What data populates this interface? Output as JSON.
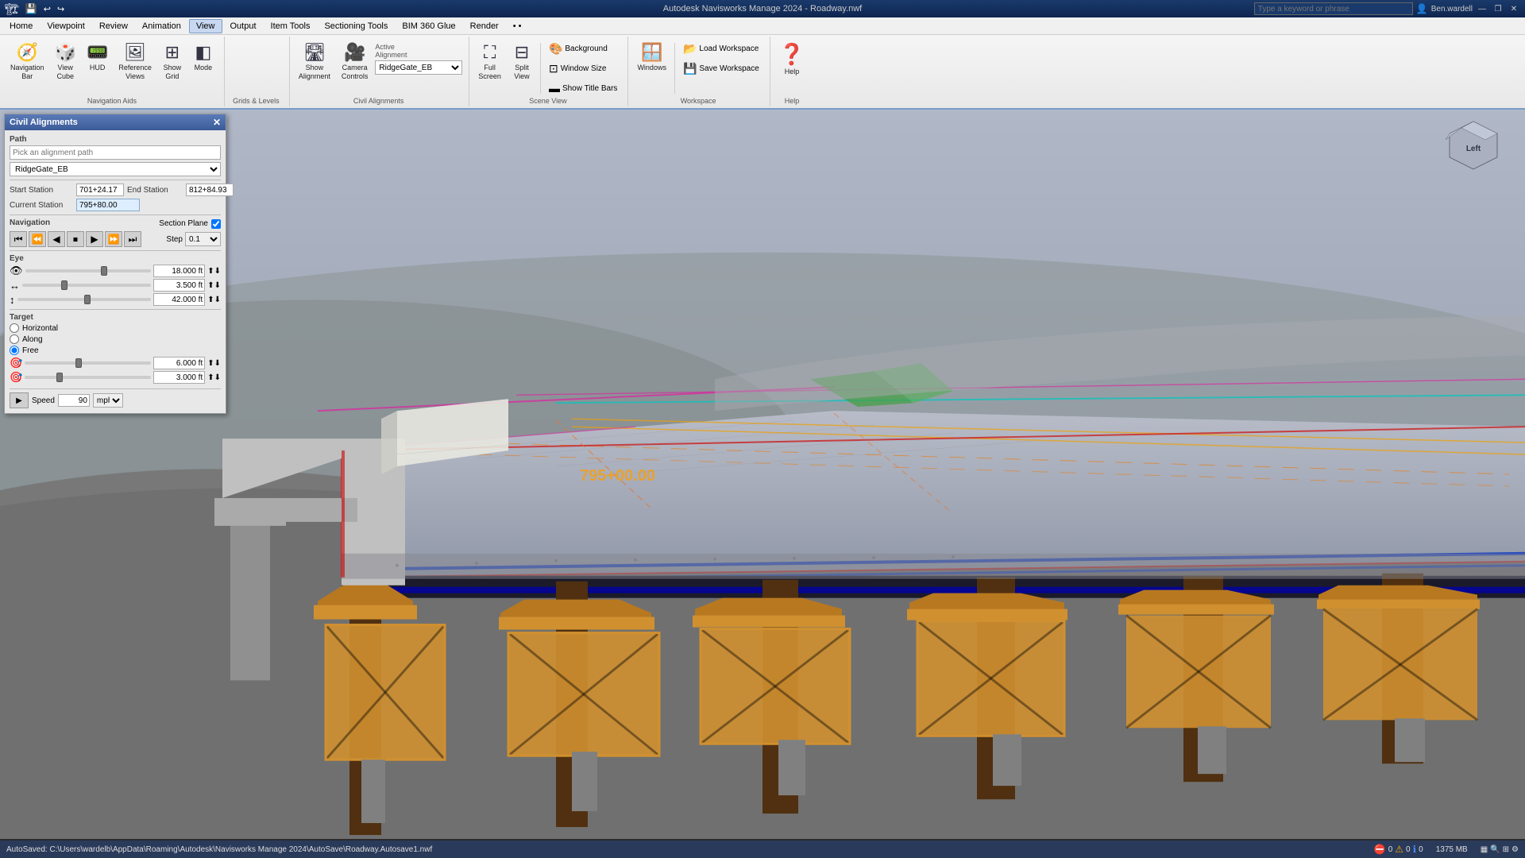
{
  "titlebar": {
    "app_name": "Autodesk Navisworks Manage 2024",
    "file": "Roadway.nwf",
    "title": "Autodesk Navisworks Manage 2024 - Roadway.nwf",
    "search_placeholder": "Type a keyword or phrase",
    "user": "Ben.wardell",
    "minimize": "—",
    "restore": "❐",
    "close": "✕"
  },
  "menu": {
    "items": [
      "Home",
      "Viewpoint",
      "Review",
      "Animation",
      "View",
      "Output",
      "Item Tools",
      "Sectioning Tools",
      "BIM 360 Glue",
      "Render",
      "• •"
    ]
  },
  "ribbon": {
    "active_tab": "View",
    "groups": [
      {
        "id": "navigation-aids",
        "label": "Navigation Aids",
        "buttons": [
          {
            "id": "navigation-bar",
            "label": "Navigation Bar",
            "icon": "🧭"
          },
          {
            "id": "view-cube",
            "label": "View Cube",
            "icon": "🎲"
          },
          {
            "id": "hud",
            "label": "HUD",
            "icon": "📟"
          },
          {
            "id": "reference-views",
            "label": "Reference Views",
            "icon": "🖼"
          },
          {
            "id": "show-grid",
            "label": "Show Grid",
            "icon": "⊞"
          },
          {
            "id": "mode",
            "label": "Mode",
            "icon": "◧"
          }
        ]
      },
      {
        "id": "grids-levels",
        "label": "Grids & Levels",
        "buttons": []
      },
      {
        "id": "civil-alignments",
        "label": "Civil Alignments",
        "buttons": [
          {
            "id": "show-alignment",
            "label": "Show Alignment",
            "icon": "🛣"
          },
          {
            "id": "camera-controls",
            "label": "Camera Controls",
            "icon": "🎥"
          }
        ],
        "active_alignment": "RidgeGate_EB",
        "alignment_label": "Active Alignment"
      },
      {
        "id": "scene-view",
        "label": "Scene View",
        "buttons": [
          {
            "id": "full-screen",
            "label": "Full Screen",
            "icon": "⛶"
          },
          {
            "id": "split-view",
            "label": "Split View",
            "icon": "⊟"
          }
        ],
        "small_buttons": [
          {
            "id": "background",
            "label": "Background",
            "icon": "🎨"
          },
          {
            "id": "window-size",
            "label": "Window Size",
            "icon": "⊡"
          },
          {
            "id": "show-title-bars",
            "label": "Show Title Bars",
            "icon": "▬"
          }
        ]
      },
      {
        "id": "workspace",
        "label": "Workspace",
        "buttons": [
          {
            "id": "windows",
            "label": "Windows",
            "icon": "🪟"
          }
        ],
        "small_buttons": [
          {
            "id": "load-workspace",
            "label": "Load Workspace",
            "icon": "📂"
          },
          {
            "id": "save-workspace",
            "label": "Save Workspace",
            "icon": "💾"
          }
        ]
      },
      {
        "id": "help",
        "label": "Help",
        "buttons": [
          {
            "id": "help-btn",
            "label": "Help",
            "icon": "❓"
          }
        ]
      }
    ]
  },
  "civil_panel": {
    "title": "Civil Alignments",
    "path_label": "Path",
    "path_placeholder": "Pick an alignment path",
    "path_value": "RidgeGate_EB",
    "start_station_label": "Start Station",
    "start_station_value": "701+24.17",
    "end_station_label": "End Station",
    "end_station_value": "812+84.93",
    "current_station_label": "Current Station",
    "current_station_value": "795+80.00",
    "navigation_label": "Navigation",
    "section_plane_label": "Section Plane",
    "section_plane_checked": true,
    "step_label": "Step",
    "step_value": "0.1",
    "eye_label": "Eye",
    "eye_values": [
      "18.000 ft",
      "3.500 ft",
      "42.000 ft"
    ],
    "target_label": "Target",
    "target_horizontal": "Horizontal",
    "target_along": "Along",
    "target_free": "Free",
    "target_free_selected": true,
    "target_values": [
      "6.000 ft",
      "3.000 ft"
    ],
    "speed_label": "Speed",
    "speed_value": "90",
    "speed_unit": "mph"
  },
  "status_bar": {
    "autosave_path": "AutoSaved: C:\\Users\\wardelb\\AppData\\Roaming\\Autodesk\\Navisworks Manage 2024\\AutoSave\\Roadway.Autosave1.nwf",
    "memory": "1375 MB",
    "coordinates": "0  0  0"
  },
  "viewport": {
    "station_label": "795+00.00"
  },
  "viewcube": {
    "label": "Left"
  }
}
